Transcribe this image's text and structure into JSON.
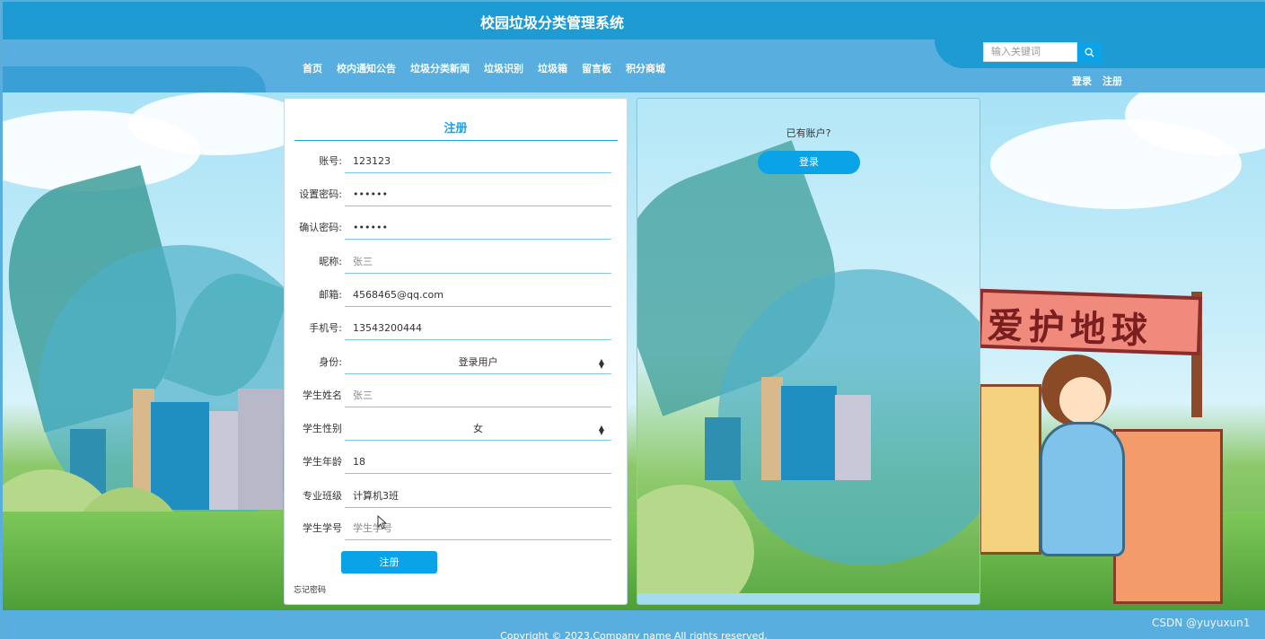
{
  "header": {
    "site_title": "校园垃圾分类管理系统",
    "nav": [
      "首页",
      "校内通知公告",
      "垃圾分类新闻",
      "垃圾识别",
      "垃圾箱",
      "留言板",
      "积分商城"
    ],
    "search_placeholder": "输入关键词",
    "login": "登录",
    "register": "注册"
  },
  "register": {
    "title": "注册",
    "fields": [
      {
        "label": "账号:",
        "value": "123123"
      },
      {
        "label": "设置密码:",
        "value": "••••••"
      },
      {
        "label": "确认密码:",
        "value": "••••••"
      },
      {
        "label": "昵称:",
        "value": "张三"
      },
      {
        "label": "邮箱:",
        "value": "4568465@qq.com"
      },
      {
        "label": "手机号:",
        "value": "13543200444"
      },
      {
        "label": "身份:",
        "value": "登录用户"
      },
      {
        "label": "学生姓名",
        "value": "张三"
      },
      {
        "label": "学生性别",
        "value": "女"
      },
      {
        "label": "学生年龄",
        "value": "18"
      },
      {
        "label": "专业班级",
        "value": "计算机3班"
      },
      {
        "label": "学生学号",
        "value": "学生学号"
      }
    ],
    "submit": "注册",
    "forgot": "忘记密码"
  },
  "side": {
    "have_account": "已有账户?",
    "login_btn": "登录"
  },
  "banner_text": "爱护地球",
  "footer": {
    "copyright": "Copyright © 2023.Company name All rights reserved."
  },
  "watermark": "CSDN @yuyuxun1",
  "colors": {
    "primary": "#1e9bd2",
    "accent": "#0aa3e8",
    "nav_bar": "#58aede"
  }
}
